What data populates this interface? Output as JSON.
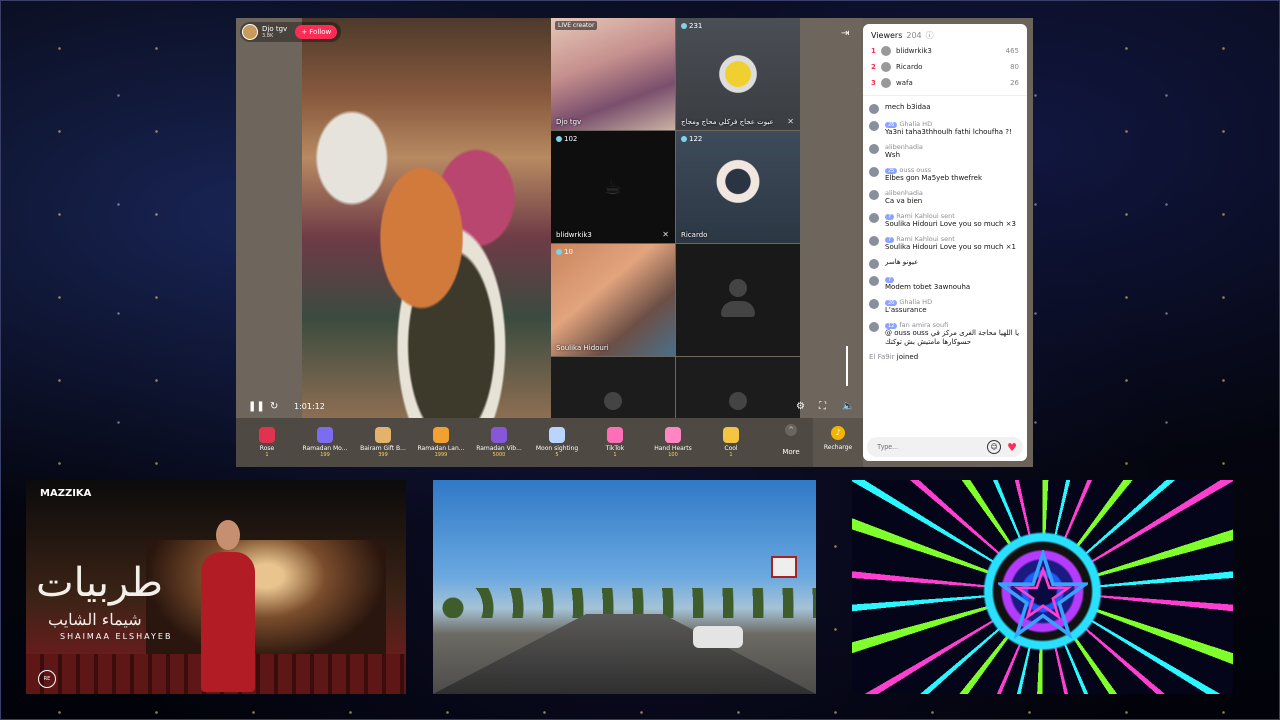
{
  "host": {
    "name": "Djo tgv",
    "followers": "3.8K",
    "follow_label": "+ Follow"
  },
  "player": {
    "time": "1:01:12"
  },
  "tiles": [
    {
      "label": "Djo tgv",
      "live": "LIVE creator"
    },
    {
      "count": "231",
      "label": "عبوت عجاج فركلي محاج ومجاج"
    },
    {
      "count": "102",
      "label": "blidwrkik3"
    },
    {
      "count": "122",
      "label": "Ricardo"
    },
    {
      "count": "10",
      "label": "Soulika Hidouri"
    }
  ],
  "gifts": [
    {
      "name": "Rose",
      "price": "1",
      "color": "#e0334f"
    },
    {
      "name": "Ramadan Mo...",
      "price": "199",
      "color": "#7b6cf0"
    },
    {
      "name": "Bairam Gift B...",
      "price": "399",
      "color": "#e3b36b"
    },
    {
      "name": "Ramadan Lan...",
      "price": "1999",
      "color": "#f0a12f"
    },
    {
      "name": "Ramadan Vib...",
      "price": "5000",
      "color": "#8657d8"
    },
    {
      "name": "Moon sighting",
      "price": "5",
      "color": "#b8d4ff"
    },
    {
      "name": "TikTok",
      "price": "1",
      "color": "#ff6fb8"
    },
    {
      "name": "Hand Hearts",
      "price": "100",
      "color": "#ff86c3"
    },
    {
      "name": "Cool",
      "price": "1",
      "color": "#f4c542"
    }
  ],
  "more_label": "More",
  "recharge_label": "Recharge",
  "viewers": {
    "title": "Viewers",
    "count": "204",
    "top": [
      {
        "rank": "1",
        "name": "blidwrkik3",
        "score": "465"
      },
      {
        "rank": "2",
        "name": "Ricardo",
        "score": "80"
      },
      {
        "rank": "3",
        "name": "wafa",
        "score": "26"
      }
    ]
  },
  "messages": [
    {
      "name": "",
      "badge": "",
      "text": "mech b3idaa"
    },
    {
      "name": "Ghalia HD",
      "badge": "26",
      "text": "Ya3ni taha3thhoulh fathi lchoufha ?!"
    },
    {
      "name": "alibenhadia",
      "badge": "",
      "text": "Wsh"
    },
    {
      "name": "ouss ouss",
      "badge": "25",
      "text": "Elbes gon Ma5yeb thwefrek"
    },
    {
      "name": "alibenhadia",
      "badge": "",
      "text": "Ca va bien"
    },
    {
      "name": "Rami Kahloui sent",
      "badge": "7",
      "text": "Soulika Hidouri  Love you so much ×3"
    },
    {
      "name": "Rami Kahloui sent",
      "badge": "7",
      "text": "Soulika Hidouri  Love you so much ×1"
    },
    {
      "name": "",
      "badge": "",
      "text": "عيونو هاسر"
    },
    {
      "name": "",
      "badge": "7",
      "text": "Modem tobet 3awnouha"
    },
    {
      "name": "Ghalia HD",
      "badge": "26",
      "text": "L'assurance"
    },
    {
      "name": "fan amira soufi",
      "badge": "12",
      "text": "@ ouss ouss يا اللهيا محاجة الغرى مركز في حسوكارها مامتيش بش توكتك"
    }
  ],
  "joined": {
    "name": "El Fa9ir",
    "text": "joined"
  },
  "input": {
    "placeholder": "Type..."
  },
  "panels": {
    "p1": {
      "logo": "MAZZIKA",
      "title": "طربيات",
      "artist_ar": "شيماء الشايب",
      "artist_en": "SHAIMAA ELSHAYEB",
      "badge": "RE"
    }
  }
}
